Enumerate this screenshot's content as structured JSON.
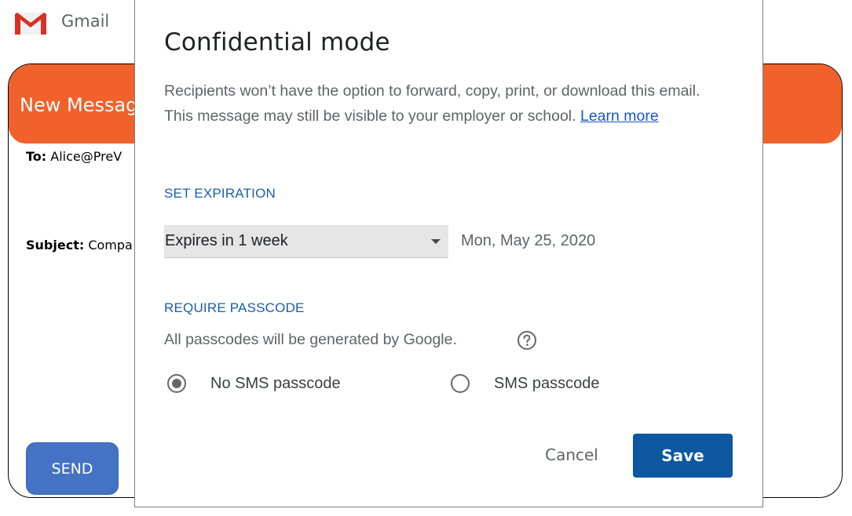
{
  "app": {
    "name": "Gmail",
    "logo_icon": "gmail-m-logo"
  },
  "compose": {
    "title": "New Message",
    "to_label": "To:",
    "to_value": "Alice@PreV",
    "subject_label": "Subject:",
    "subject_value": "Compa",
    "send_label": "SEND",
    "header_color": "#f0612b",
    "send_color": "#4472c4"
  },
  "dialog": {
    "title": "Confidential mode",
    "description": "Recipients won’t have the option to forward, copy, print, or download this email. This message may still be visible to your employer or school.",
    "learn_more": "Learn more",
    "expiration": {
      "label": "SET EXPIRATION",
      "selected": "Expires in 1 week",
      "date": "Mon, May 25, 2020"
    },
    "passcode": {
      "label": "REQUIRE PASSCODE",
      "note": "All passcodes will be generated by Google.",
      "help_icon": "help-circle-icon",
      "options": [
        {
          "label": "No SMS passcode",
          "selected": true
        },
        {
          "label": "SMS passcode",
          "selected": false
        }
      ]
    },
    "cancel_label": "Cancel",
    "save_label": "Save",
    "accent_color": "#0b57a0",
    "section_color": "#1a5ea8"
  }
}
